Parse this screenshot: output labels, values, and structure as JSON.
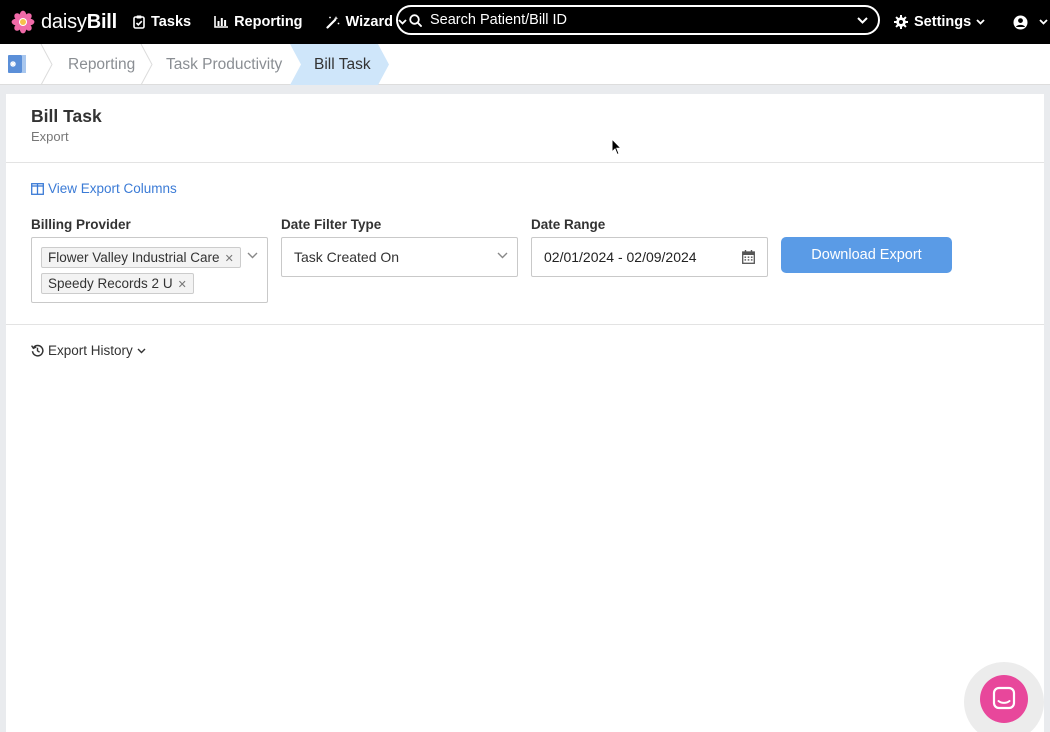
{
  "nav": {
    "logo": {
      "prefix": "daisy",
      "suffix": "Bill",
      "icon": "daisy-flower-logo"
    },
    "items": [
      {
        "label": "Tasks",
        "icon": "clipboard-check-icon"
      },
      {
        "label": "Reporting",
        "icon": "bar-chart-icon"
      },
      {
        "label": "Wizard",
        "icon": "magic-wand-icon"
      }
    ],
    "search_placeholder": "Search Patient/Bill ID",
    "settings_label": "Settings",
    "user_icon": "user-circle-icon"
  },
  "breadcrumb": {
    "items": [
      "Reporting",
      "Task Productivity",
      "Bill Task"
    ],
    "active_color": "#cfe6fa"
  },
  "page": {
    "title": "Bill Task",
    "subtitle": "Export"
  },
  "form": {
    "view_columns_link": "View Export Columns",
    "billing_provider": {
      "label": "Billing Provider",
      "selected": [
        "Flower Valley Industrial Care",
        "Speedy Records 2 U"
      ]
    },
    "date_filter_type": {
      "label": "Date Filter Type",
      "value": "Task Created On"
    },
    "date_range": {
      "label": "Date Range",
      "value": "02/01/2024 - 02/09/2024"
    },
    "download_button": "Download Export"
  },
  "export_history": {
    "label": "Export History"
  },
  "colors": {
    "accent": "#5a9be6",
    "link": "#3b7bd6",
    "chat": "#e8479b"
  }
}
